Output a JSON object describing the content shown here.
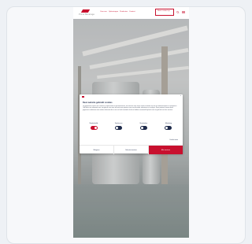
{
  "site": {
    "brand": "Prime Beverage",
    "nav": [
      "Over ons",
      "Oplossingen",
      "Producten",
      "Contact"
    ],
    "cta": "Neem contact op"
  },
  "cookie": {
    "close": "×",
    "title": "Deze website gebruikt cookies",
    "body": "Wij gebruiken cookies om content en advertenties te personaliseren, om functies voor social media te bieden en om ons websiteverkeer te analyseren. Ook delen we informatie over uw gebruik van onze site met onze partners voor social media, adverteren en analyse. Deze partners kunnen deze gegevens combineren met andere informatie die u aan ze heeft verstrekt of die ze hebben verzameld op basis van uw gebruik van hun services.",
    "categories": [
      {
        "label": "Noodzakelijk",
        "on": true
      },
      {
        "label": "Voorkeuren",
        "on": false
      },
      {
        "label": "Statistieken",
        "on": false
      },
      {
        "label": "Marketing",
        "on": false
      }
    ],
    "details": "Details tonen",
    "buttons": {
      "deny": "Weigeren",
      "allow_selection": "Selectie toestaan",
      "allow_all": "Alle toestaan"
    }
  },
  "colors": {
    "accent": "#c8102e",
    "text": "#1e2a4a"
  }
}
